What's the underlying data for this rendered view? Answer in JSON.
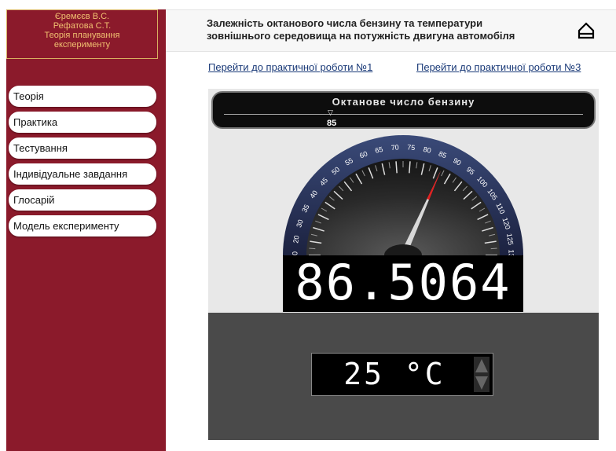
{
  "sidebar": {
    "authors": [
      "Єремєєв В.С.",
      "Рефатова С.Т.",
      "Теорія планування",
      "експерименту"
    ],
    "items": [
      {
        "label": "Теорія"
      },
      {
        "label": "Практика"
      },
      {
        "label": "Тестування"
      },
      {
        "label": "Індивідуальне завдання"
      },
      {
        "label": "Глосарій"
      },
      {
        "label": "Модель експерименту"
      }
    ]
  },
  "header": {
    "title_line1": "Залежність октанового числа бензину та температури",
    "title_line2": "зовнішнього середовища на потужність двигуна автомобіля"
  },
  "links": {
    "link1": "Перейти до практичної роботи №1",
    "link3": "Перейти до практичної роботи №3"
  },
  "experiment": {
    "slider_title": "Октанове число бензину",
    "slider_value": "85",
    "gauge_ticks": [
      "10",
      "20",
      "30",
      "35",
      "40",
      "45",
      "50",
      "55",
      "60",
      "65",
      "70",
      "75",
      "80",
      "85",
      "90",
      "95",
      "100",
      "105",
      "110",
      "120",
      "125",
      "130"
    ],
    "gauge_reading": 86.5064,
    "display_value": "86.5064",
    "temperature": "25 °C"
  },
  "colors": {
    "sidebar_bg": "#8b1a2b",
    "author_text": "#f0c070",
    "link": "#1a3a78",
    "needle": "#e02020"
  }
}
